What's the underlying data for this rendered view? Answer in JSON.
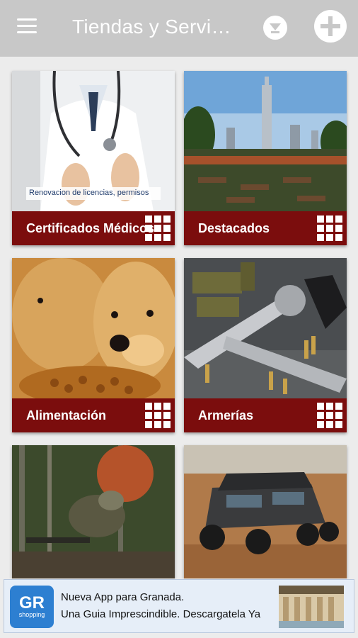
{
  "appbar": {
    "title": "Tiendas y Servici…",
    "menu_icon": "hamburger-menu-icon",
    "filter_icon": "filter-icon",
    "add_icon": "plus-icon",
    "bg_color": "#c8c8c8"
  },
  "categories": [
    {
      "label": "Certificados Médicos",
      "caption": "Renovacion de licencias, permisos",
      "image": "doctor-stethoscope"
    },
    {
      "label": "Destacados",
      "image": "city-terrace"
    },
    {
      "label": "Alimentación",
      "image": "puppies-eating"
    },
    {
      "label": "Armerías",
      "image": "revolvers-ammo"
    },
    {
      "label": "",
      "image": "camouflaged-hunter"
    },
    {
      "label": "",
      "image": "offroad-vehicle"
    }
  ],
  "card_footer_color": "#7b0d0d",
  "ad": {
    "logo_text": "GR",
    "logo_sub": "shopping",
    "title": "Nueva App para Granada.",
    "subtitle": "Una Guia Imprescindible. Descargatela Ya",
    "thumb": "alhambra-courtyard"
  }
}
